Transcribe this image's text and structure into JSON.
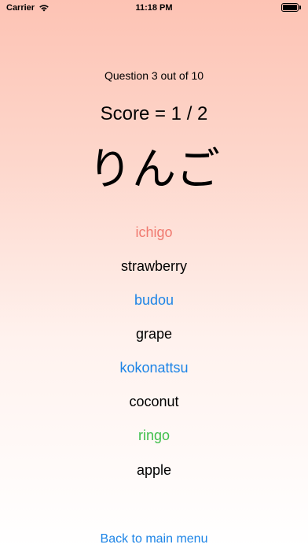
{
  "status_bar": {
    "carrier": "Carrier",
    "time": "11:18 PM",
    "icons": [
      "wifi-icon",
      "battery-icon"
    ]
  },
  "quiz": {
    "question_counter": "Question 3 out of 10",
    "score": "Score = 1 / 2",
    "kana_word": "りんご",
    "options": [
      {
        "romaji": "ichigo",
        "meaning": "strawberry",
        "romaji_color": "#f07a70"
      },
      {
        "romaji": "budou",
        "meaning": "grape",
        "romaji_color": "#1d84e6"
      },
      {
        "romaji": "kokonattsu",
        "meaning": "coconut",
        "romaji_color": "#1d84e6"
      },
      {
        "romaji": "ringo",
        "meaning": "apple",
        "romaji_color": "#3fbf4c"
      }
    ]
  },
  "footer": {
    "back_label": "Back to main menu"
  },
  "colors": {
    "accent_blue": "#1d84e6",
    "wrong_red": "#f07a70",
    "correct_green": "#3fbf4c",
    "gradient_top": "#fdc3b4"
  }
}
